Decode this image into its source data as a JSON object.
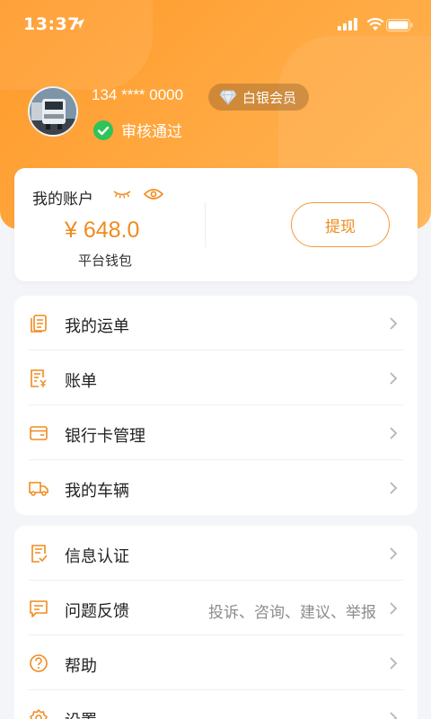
{
  "status": {
    "time": "13:37"
  },
  "profile": {
    "phone": "134 **** 0000",
    "badge": "白银会员",
    "verified": "审核通过"
  },
  "account": {
    "title": "我的账户",
    "amount": "¥ 648.0",
    "wallet_label": "平台钱包",
    "withdraw_label": "提现"
  },
  "menu1": [
    {
      "label": "我的运单",
      "icon": "waybill-icon"
    },
    {
      "label": "账单",
      "icon": "bill-icon"
    },
    {
      "label": "银行卡管理",
      "icon": "bank-card-icon"
    },
    {
      "label": "我的车辆",
      "icon": "truck-icon"
    }
  ],
  "menu2": [
    {
      "label": "信息认证",
      "icon": "certification-icon"
    },
    {
      "label": "问题反馈",
      "sub": "投诉、咨询、建议、举报",
      "icon": "feedback-icon"
    },
    {
      "label": "帮助",
      "icon": "help-icon"
    },
    {
      "label": "设置",
      "icon": "settings-icon"
    }
  ],
  "colors": {
    "accent": "#f08b1e",
    "hero": "#ff9a2a",
    "verified_green": "#2fc35a"
  }
}
